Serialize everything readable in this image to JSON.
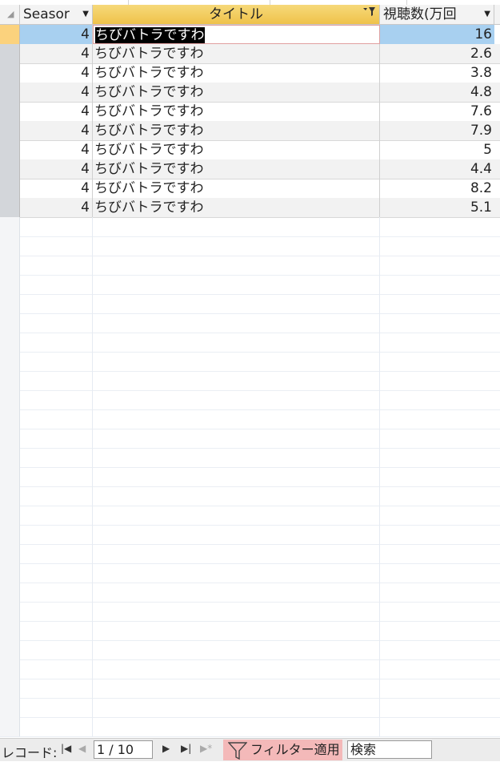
{
  "columns": [
    {
      "label": "Seasor",
      "dropdown": "dropdown-arrow-icon"
    },
    {
      "label": "タイトル",
      "dropdown": "filter-dropdown-icon"
    },
    {
      "label": "視聴数(万回",
      "dropdown": "dropdown-arrow-icon"
    }
  ],
  "rows": [
    {
      "season": "4",
      "title": "ちびバトラですわ",
      "views": "16"
    },
    {
      "season": "4",
      "title": "ちびバトラですわ",
      "views": "2.6"
    },
    {
      "season": "4",
      "title": "ちびバトラですわ",
      "views": "3.8"
    },
    {
      "season": "4",
      "title": "ちびバトラですわ",
      "views": "4.8"
    },
    {
      "season": "4",
      "title": "ちびバトラですわ",
      "views": "7.6"
    },
    {
      "season": "4",
      "title": "ちびバトラですわ",
      "views": "7.9"
    },
    {
      "season": "4",
      "title": "ちびバトラですわ",
      "views": "5"
    },
    {
      "season": "4",
      "title": "ちびバトラですわ",
      "views": "4.4"
    },
    {
      "season": "4",
      "title": "ちびバトラですわ",
      "views": "8.2"
    },
    {
      "season": "4",
      "title": "ちびバトラですわ",
      "views": "5.1"
    }
  ],
  "navigation": {
    "label": "レコード:",
    "record_position": "1 / 10",
    "filter_label": "フィルター適用",
    "search_value": "検索"
  },
  "colors": {
    "selected_header": "#f6d97a",
    "selected_row": "#a8d0f0",
    "filter_badge": "#f4b9b9"
  }
}
